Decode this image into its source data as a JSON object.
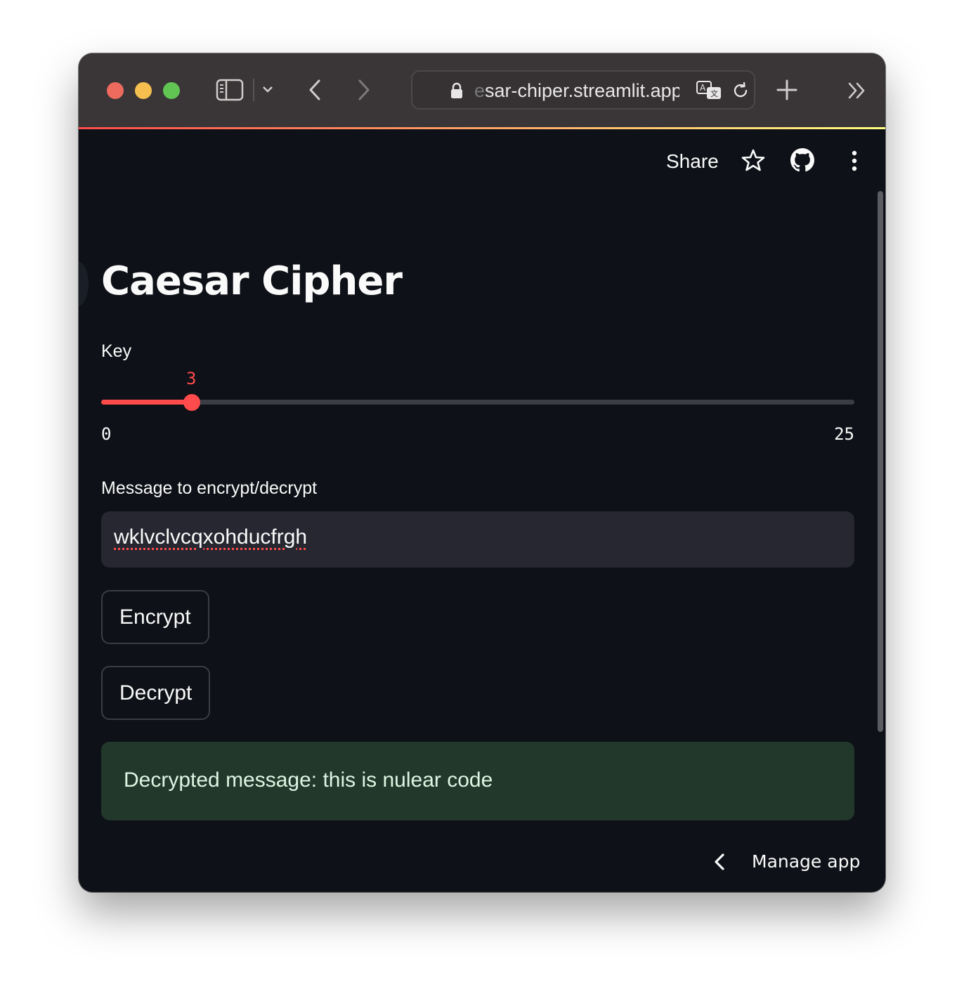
{
  "browser": {
    "url_faded": "e",
    "url": "sar-chiper.streamlit.app"
  },
  "app": {
    "share_label": "Share",
    "title": "Caesar Cipher",
    "key": {
      "label": "Key",
      "value": 3,
      "value_text": "3",
      "min": 0,
      "max": 25,
      "min_label": "0",
      "max_label": "25"
    },
    "message": {
      "label": "Message to encrypt/decrypt",
      "value": "wklvclvcqxohducfrgh"
    },
    "encrypt_label": "Encrypt",
    "decrypt_label": "Decrypt",
    "result": "Decrypted message: this is nulear code",
    "manage_label": "Manage app"
  },
  "colors": {
    "accent": "#ff4b4b",
    "background": "#0e1117",
    "success_bg": "#21382a"
  }
}
